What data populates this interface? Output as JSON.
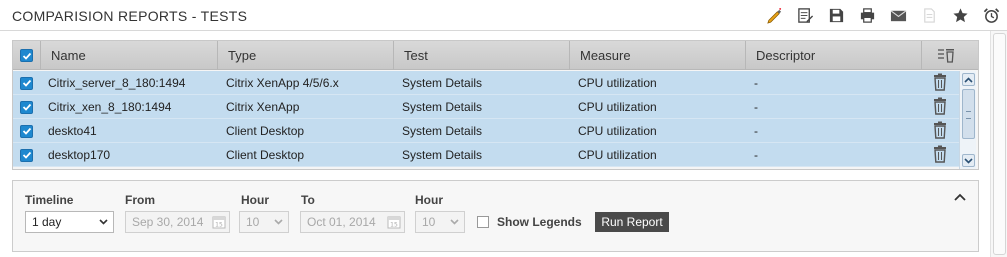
{
  "header": {
    "title": "COMPARISION REPORTS - TESTS",
    "toolbar": [
      "edit-icon",
      "report-icon",
      "save-icon",
      "print-icon",
      "mail-icon",
      "document-icon",
      "favorite-icon",
      "alarm-clock-icon"
    ]
  },
  "table": {
    "columns": [
      "Name",
      "Type",
      "Test",
      "Measure",
      "Descriptor"
    ],
    "rows": [
      {
        "name": "Citrix_server_8_180:1494",
        "type": "Citrix XenApp 4/5/6.x",
        "test": "System Details",
        "measure": "CPU utilization",
        "descriptor": "-"
      },
      {
        "name": "Citrix_xen_8_180:1494",
        "type": "Citrix XenApp",
        "test": "System Details",
        "measure": "CPU utilization",
        "descriptor": "-"
      },
      {
        "name": "deskto41",
        "type": "Client Desktop",
        "test": "System Details",
        "measure": "CPU utilization",
        "descriptor": "-"
      },
      {
        "name": "desktop170",
        "type": "Client Desktop",
        "test": "System Details",
        "measure": "CPU utilization",
        "descriptor": "-"
      }
    ]
  },
  "filters": {
    "timeline_label": "Timeline",
    "timeline_value": "1 day",
    "from_label": "From",
    "from_value": "Sep 30, 2014",
    "hour_label": "Hour",
    "from_hour": "10",
    "to_label": "To",
    "to_value": "Oct 01, 2014",
    "to_hour_label": "Hour",
    "to_hour": "10",
    "show_legends_label": "Show Legends",
    "run_report_label": "Run Report"
  },
  "colors": {
    "row_selected": "#c3dcef",
    "checkbox": "#1e88cf",
    "button": "#4a4a4a"
  }
}
